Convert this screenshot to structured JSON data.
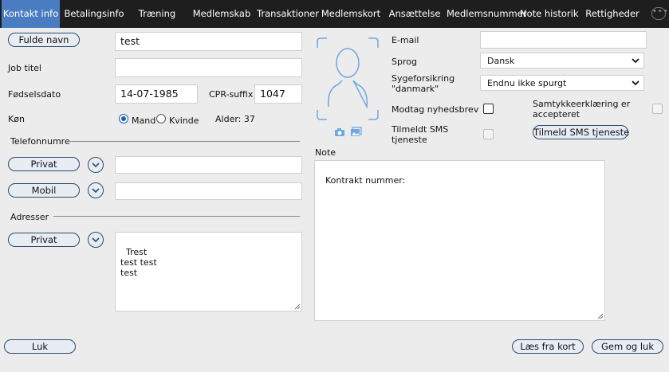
{
  "tabs": [
    {
      "label": "Kontakt info",
      "active": true
    },
    {
      "label": "Betalingsinfo"
    },
    {
      "label": "Træning"
    },
    {
      "label": "Medlemskab"
    },
    {
      "label": "Transaktioner"
    },
    {
      "label": "Medlemskort"
    },
    {
      "label": "Ansættelse"
    },
    {
      "label": "Medlemsnummer"
    },
    {
      "label": "Note historik"
    },
    {
      "label": "Rettigheder"
    }
  ],
  "more_icon": "ellipsis-icon",
  "contact": {
    "name_button": "Fulde navn",
    "name_value": "test",
    "job_title_label": "Job titel",
    "job_title_value": "",
    "birthdate_label": "Fødselsdato",
    "birthdate_value": "14-07-1985",
    "cpr_label": "CPR-suffix",
    "cpr_value": "1047",
    "gender_label": "Køn",
    "gender_male": "Mand",
    "gender_female": "Kvinde",
    "gender_selected": "Mand",
    "age_text": "Alder: 37"
  },
  "phones": {
    "section_label": "Telefonnumre",
    "items": [
      {
        "type": "Privat",
        "value": ""
      },
      {
        "type": "Mobil",
        "value": ""
      }
    ]
  },
  "addresses": {
    "section_label": "Adresser",
    "items": [
      {
        "type": "Privat",
        "value": "Trest\ntest test\ntest"
      }
    ]
  },
  "photo": {
    "avatar_icon": "person-silhouette-icon",
    "camera_icon": "camera-icon",
    "gallery_icon": "image-icon"
  },
  "right": {
    "email_label": "E-mail",
    "email_value": "",
    "language_label": "Sprog",
    "language_value": "Dansk",
    "insurance_label": "Sygeforsikring \"danmark\"",
    "insurance_value": "Endnu ikke spurgt",
    "newsletter_label": "Modtag nyhedsbrev",
    "newsletter_checked": false,
    "consent_label": "Samtykkeerklæring er accepteret",
    "consent_checked": false,
    "sms_label": "Tilmeldt SMS tjeneste",
    "sms_checked": false,
    "sms_button": "Tilmeld SMS tjeneste"
  },
  "note": {
    "label": "Note",
    "value": "Kontrakt nummer:"
  },
  "footer": {
    "close_button": "Luk",
    "read_card_button": "Læs fra kort",
    "save_close_button": "Gem og luk"
  },
  "colors": {
    "tab_bg": "#1e1e1e",
    "tab_active": "#4a7cc2",
    "avatar": "#6fa8dc",
    "accent": "#1a5fb4"
  }
}
